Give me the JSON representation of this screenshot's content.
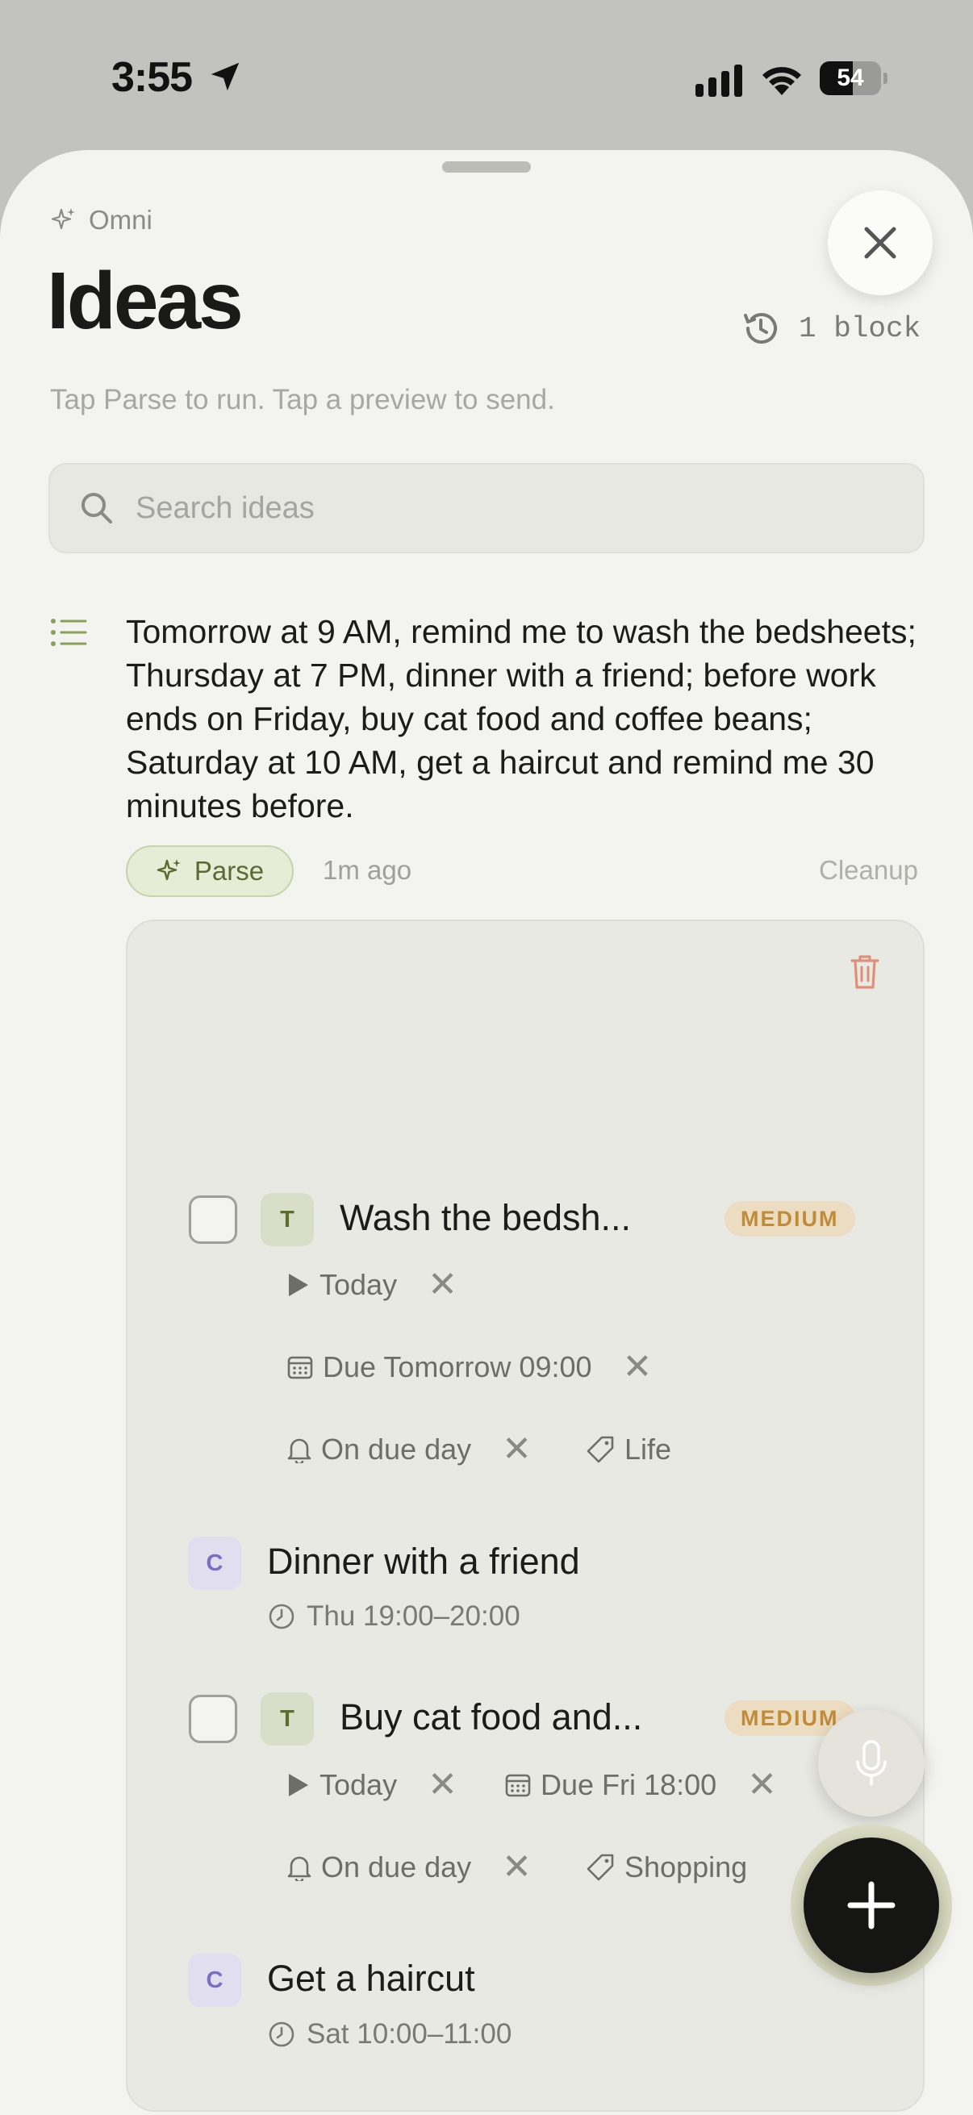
{
  "status_bar": {
    "time": "3:55",
    "battery_level": 54,
    "battery_label": "54"
  },
  "header": {
    "app_label": "Omni",
    "title": "Ideas",
    "history_label": "1 block",
    "subtitle": "Tap Parse to run. Tap a preview to send."
  },
  "search": {
    "placeholder": "Search ideas"
  },
  "idea": {
    "text": "Tomorrow at 9 AM, remind me to wash the bedsheets; Thursday at 7 PM, dinner with a friend; before work ends on Friday, buy cat food and coffee beans; Saturday at 10 AM, get a haircut and remind me 30 minutes before.",
    "parse_label": "Parse",
    "time_ago": "1m ago",
    "cleanup_label": "Cleanup"
  },
  "previews": {
    "task1": {
      "badge": "T",
      "title": "Wash the bedsh...",
      "priority": "MEDIUM",
      "start": "Today",
      "due": "Due Tomorrow 09:00",
      "reminder": "On due day",
      "tag": "Life"
    },
    "event1": {
      "badge": "C",
      "title": "Dinner with a friend",
      "time": "Thu 19:00–20:00"
    },
    "task2": {
      "badge": "T",
      "title": "Buy cat food and...",
      "priority": "MEDIUM",
      "start": "Today",
      "due": "Due Fri 18:00",
      "reminder": "On due day",
      "tag": "Shopping"
    },
    "event2": {
      "badge": "C",
      "title": "Get a haircut",
      "time": "Sat 10:00–11:00"
    }
  },
  "colors": {
    "accent_green": "#5c6a32",
    "priority_medium": "#c08c3a",
    "event_purple": "#7d6ec4",
    "trash_red": "#e0907a"
  }
}
